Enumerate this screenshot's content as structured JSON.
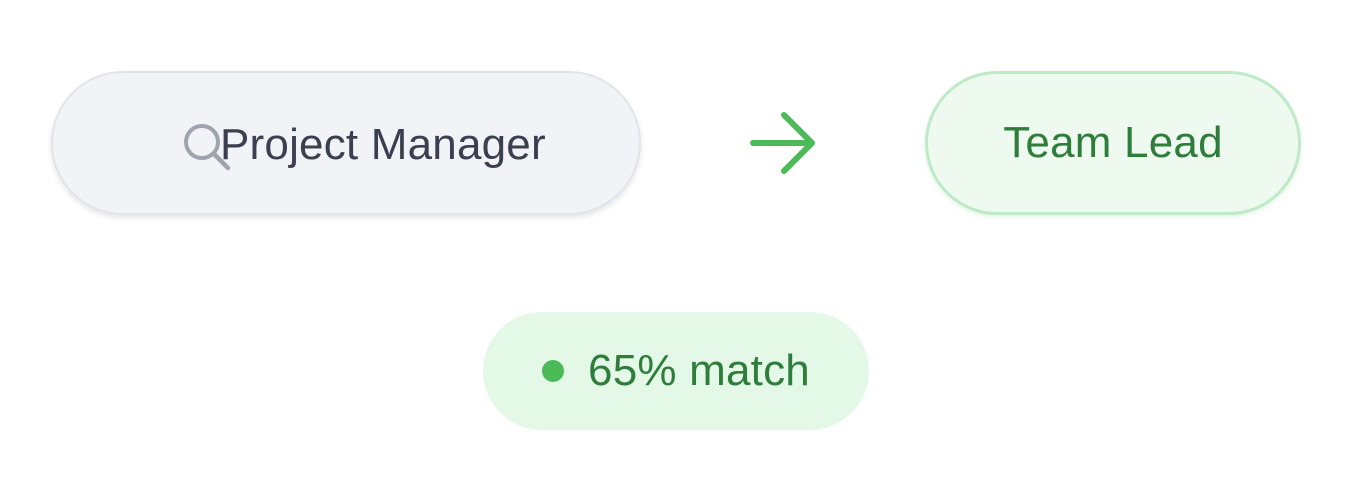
{
  "search": {
    "icon": "search-icon",
    "value": "Project Manager"
  },
  "transition": {
    "icon": "arrow-right-icon",
    "color": "#4cba58"
  },
  "target": {
    "label": "Team Lead"
  },
  "match": {
    "label": "65% match",
    "percent": 65,
    "dot_color": "#4cba58"
  },
  "colors": {
    "accent_green": "#4cba58",
    "text_green": "#2f7d3a",
    "text_dark": "#3a4050",
    "pill_gray": "#f2f3f6",
    "pill_green": "#eefaf0"
  }
}
